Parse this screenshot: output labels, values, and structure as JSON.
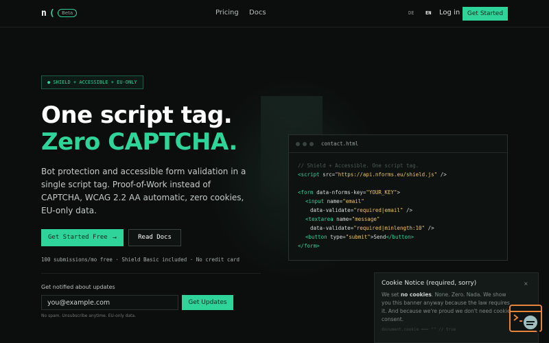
{
  "nav": {
    "logo_letter": "n",
    "logo_paren": "(",
    "badge": "Beta",
    "links": [
      "Pricing",
      "Docs"
    ],
    "languages": [
      "DE",
      "EN"
    ],
    "active_language": "EN",
    "login": "Log in",
    "cta": "Get Started"
  },
  "hero": {
    "badge": "● SHIELD + ACCESSIBLE + EU-ONLY",
    "title_line1": "One script tag.",
    "title_line2": "Zero CAPTCHA.",
    "lead": "Bot protection and accessible form validation in a single script tag. Proof-of-Work instead of CAPTCHA, WCAG 2.2 AA automatic, zero cookies, EU-only data.",
    "primary_button": "Get Started Free",
    "secondary_button": "Read Docs",
    "fineprint": "100 submissions/mo free · Shield Basic included · No credit card"
  },
  "newsletter": {
    "label": "Get notified about updates",
    "placeholder": "you@example.com",
    "button": "Get Updates",
    "note": "No spam. Unsubscribe anytime. EU-only data."
  },
  "code_card": {
    "filename": "contact.html",
    "comment": "// Shield + Accessible. One script tag.",
    "script_open": "<script",
    "script_attr": " src=",
    "script_src": "\"https://api.nforms.eu/shield.js\"",
    "script_close": " />",
    "form_open": "<form",
    "form_attr": " data-nforms-key=",
    "form_key": "\"YOUR_KEY\"",
    "form_close": ">",
    "input_open": "<input",
    "input_attr": " name=",
    "input_name": "\"email\"",
    "input_validate_attr": "data-validate=",
    "input_validate": "\"required|email\"",
    "input_close": " />",
    "textarea_open": "<textarea",
    "textarea_attr": " name=",
    "textarea_name": "\"message\"",
    "textarea_validate_attr": "data-validate=",
    "textarea_validate": "\"required|minlength:10\"",
    "textarea_close": " />",
    "button_open": "<button",
    "button_attr": " type=",
    "button_type": "\"submit\"",
    "button_text": ">Send",
    "button_close": "</button>",
    "form_end": "</form>"
  },
  "cookie": {
    "title": "Cookie Notice (required, sorry)",
    "close": "×",
    "text_prefix": "We set ",
    "text_bold": "no cookies",
    "text_rest": ". None. Zero. Nada. We show you this banner anyway because the law requires it. And because we're proud we don't need cookies consent.",
    "code": "document.cookie === \"\" // true"
  },
  "colors": {
    "accent": "#2fd49a",
    "background": "#0b0e0d",
    "code_string": "#f0c35c",
    "widget": "#e8843c"
  },
  "icons": [
    "arrow-right-icon",
    "close-icon",
    "help-widget-icon"
  ]
}
